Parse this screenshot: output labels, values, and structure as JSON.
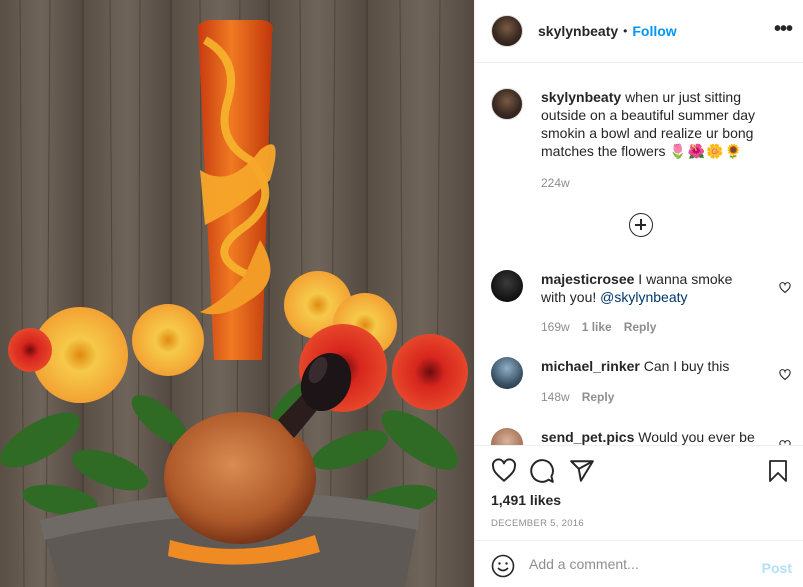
{
  "post": {
    "username": "skylynbeaty",
    "follow_dot": "•",
    "follow_label": "Follow",
    "more_label": "•••",
    "caption_text": "when ur just sitting outside on a beautiful summer day smokin a bowl and realize ur bong matches the flowers",
    "caption_emoji": "🌷🌺🌼🌻",
    "caption_time": "224w"
  },
  "comments": [
    {
      "username": "majesticrosee",
      "text": "I wanna smoke with you!",
      "mention": "@skylynbeaty",
      "time": "169w",
      "likes": "1 like",
      "reply": "Reply"
    },
    {
      "username": "michael_rinker",
      "text": "Can I buy this",
      "time": "148w",
      "reply": "Reply"
    },
    {
      "username": "send_pet.pics",
      "text": "Would you ever be"
    }
  ],
  "stats": {
    "likes": "1,491 likes",
    "date": "DECEMBER 5, 2016"
  },
  "composer": {
    "placeholder": "Add a comment...",
    "post_label": "Post"
  },
  "icons": {
    "like": "heart-icon",
    "comment": "comment-icon",
    "share": "share-icon",
    "save": "bookmark-icon",
    "emoji": "emoji-icon",
    "load_more": "plus-circle-icon",
    "comment_like": "heart-outline-icon"
  },
  "colors": {
    "accent": "#0095f6",
    "post_disabled": "#b2dffc",
    "muted": "#8e8e8e",
    "text": "#262626"
  }
}
